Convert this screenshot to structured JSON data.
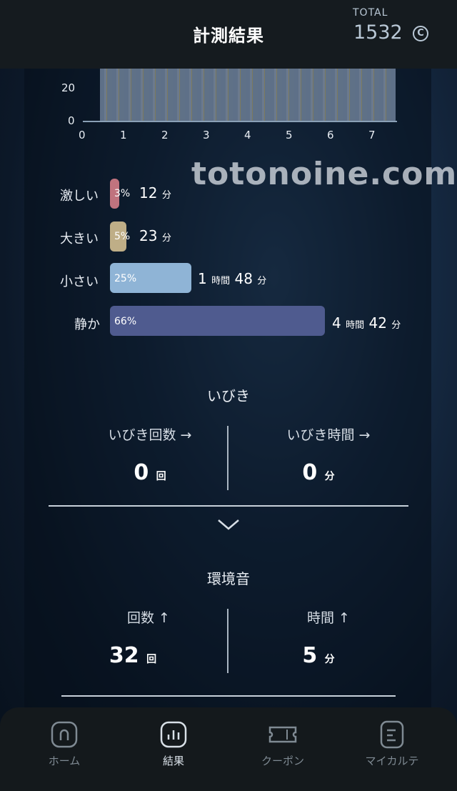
{
  "header": {
    "title": "計測結果",
    "total_label": "TOTAL",
    "total_value": "1532",
    "coin_symbol": "C"
  },
  "graph": {
    "y_ticks": [
      "20",
      "0"
    ],
    "x_ticks": [
      "0",
      "1",
      "2",
      "3",
      "4",
      "5",
      "6",
      "7"
    ]
  },
  "watermark": "totonoine.com",
  "levels": [
    {
      "label": "激しい",
      "percent": "3%",
      "hours": "",
      "hours_unit": "",
      "minutes": "12",
      "minutes_unit": "分",
      "color": "#c0737e"
    },
    {
      "label": "大きい",
      "percent": "5%",
      "hours": "",
      "hours_unit": "",
      "minutes": "23",
      "minutes_unit": "分",
      "color": "#bfae87"
    },
    {
      "label": "小さい",
      "percent": "25%",
      "hours": "1",
      "hours_unit": "時間",
      "minutes": "48",
      "minutes_unit": "分",
      "color": "#8fb4d6"
    },
    {
      "label": "静か",
      "percent": "66%",
      "hours": "4",
      "hours_unit": "時間",
      "minutes": "42",
      "minutes_unit": "分",
      "color": "#4f5b8f"
    }
  ],
  "snoring": {
    "title": "いびき",
    "count_label": "いびき回数 →",
    "count_value": "0",
    "count_unit": "回",
    "time_label": "いびき時間 →",
    "time_value": "0",
    "time_unit": "分"
  },
  "environment": {
    "title": "環境音",
    "count_label": "回数 ↑",
    "count_value": "32",
    "count_unit": "回",
    "time_label": "時間 ↑",
    "time_value": "5",
    "time_unit": "分"
  },
  "nav": {
    "items": [
      {
        "label": "ホーム",
        "icon": "home-icon",
        "active": false
      },
      {
        "label": "結果",
        "icon": "chart-icon",
        "active": true
      },
      {
        "label": "クーポン",
        "icon": "ticket-icon",
        "active": false
      },
      {
        "label": "マイカルテ",
        "icon": "chart-card-icon",
        "active": false
      }
    ]
  }
}
